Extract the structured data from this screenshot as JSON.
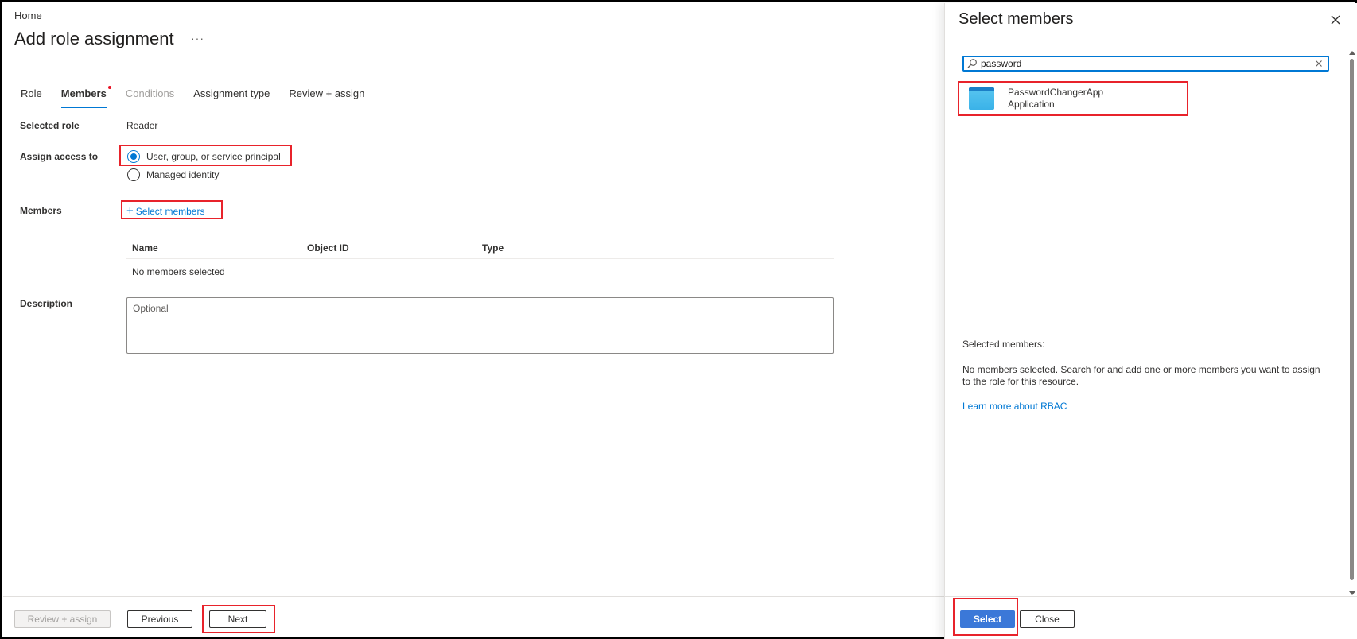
{
  "breadcrumb": "Home",
  "page": {
    "title": "Add role assignment",
    "more_label": "···"
  },
  "tabs": [
    {
      "label": "Role"
    },
    {
      "label": "Members"
    },
    {
      "label": "Conditions"
    },
    {
      "label": "Assignment type"
    },
    {
      "label": "Review + assign"
    }
  ],
  "form": {
    "selected_role_label": "Selected role",
    "selected_role_value": "Reader",
    "assign_access_label": "Assign access to",
    "assign_options": [
      "User, group, or service principal",
      "Managed identity"
    ],
    "members_label": "Members",
    "select_members_link": "Select members",
    "table_headers": [
      "Name",
      "Object ID",
      "Type"
    ],
    "table_empty": "No members selected",
    "description_label": "Description",
    "description_placeholder": "Optional"
  },
  "footer": {
    "review_assign": "Review + assign",
    "previous": "Previous",
    "next": "Next"
  },
  "panel": {
    "title": "Select members",
    "search_value": "password",
    "result": {
      "name": "PasswordChangerApp",
      "type": "Application"
    },
    "selected_members_label": "Selected members:",
    "empty_text": "No members selected. Search for and add one or more members you want to assign to the role for this resource.",
    "learn_more": "Learn more about RBAC",
    "select_button": "Select",
    "close_button": "Close"
  },
  "colors": {
    "accent": "#0078d4",
    "highlight_box": "#e8232b",
    "primary_button": "#3b78d8"
  },
  "icons": [
    "more-icon",
    "plus-icon",
    "close-icon",
    "search-icon",
    "clear-icon",
    "app-registration-icon"
  ]
}
